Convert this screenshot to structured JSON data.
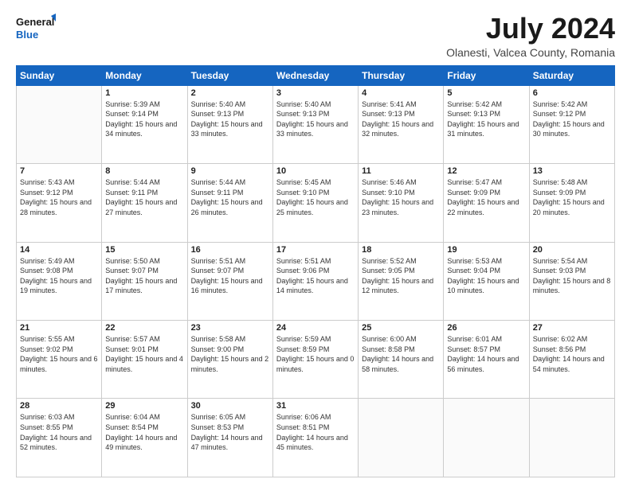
{
  "logo": {
    "line1": "General",
    "line2": "Blue"
  },
  "title": "July 2024",
  "subtitle": "Olanesti, Valcea County, Romania",
  "days": [
    "Sunday",
    "Monday",
    "Tuesday",
    "Wednesday",
    "Thursday",
    "Friday",
    "Saturday"
  ],
  "weeks": [
    [
      {
        "num": "",
        "sunrise": "",
        "sunset": "",
        "daylight": ""
      },
      {
        "num": "1",
        "sunrise": "5:39 AM",
        "sunset": "9:14 PM",
        "daylight": "15 hours and 34 minutes."
      },
      {
        "num": "2",
        "sunrise": "5:40 AM",
        "sunset": "9:13 PM",
        "daylight": "15 hours and 33 minutes."
      },
      {
        "num": "3",
        "sunrise": "5:40 AM",
        "sunset": "9:13 PM",
        "daylight": "15 hours and 33 minutes."
      },
      {
        "num": "4",
        "sunrise": "5:41 AM",
        "sunset": "9:13 PM",
        "daylight": "15 hours and 32 minutes."
      },
      {
        "num": "5",
        "sunrise": "5:42 AM",
        "sunset": "9:13 PM",
        "daylight": "15 hours and 31 minutes."
      },
      {
        "num": "6",
        "sunrise": "5:42 AM",
        "sunset": "9:12 PM",
        "daylight": "15 hours and 30 minutes."
      }
    ],
    [
      {
        "num": "7",
        "sunrise": "5:43 AM",
        "sunset": "9:12 PM",
        "daylight": "15 hours and 28 minutes."
      },
      {
        "num": "8",
        "sunrise": "5:44 AM",
        "sunset": "9:11 PM",
        "daylight": "15 hours and 27 minutes."
      },
      {
        "num": "9",
        "sunrise": "5:44 AM",
        "sunset": "9:11 PM",
        "daylight": "15 hours and 26 minutes."
      },
      {
        "num": "10",
        "sunrise": "5:45 AM",
        "sunset": "9:10 PM",
        "daylight": "15 hours and 25 minutes."
      },
      {
        "num": "11",
        "sunrise": "5:46 AM",
        "sunset": "9:10 PM",
        "daylight": "15 hours and 23 minutes."
      },
      {
        "num": "12",
        "sunrise": "5:47 AM",
        "sunset": "9:09 PM",
        "daylight": "15 hours and 22 minutes."
      },
      {
        "num": "13",
        "sunrise": "5:48 AM",
        "sunset": "9:09 PM",
        "daylight": "15 hours and 20 minutes."
      }
    ],
    [
      {
        "num": "14",
        "sunrise": "5:49 AM",
        "sunset": "9:08 PM",
        "daylight": "15 hours and 19 minutes."
      },
      {
        "num": "15",
        "sunrise": "5:50 AM",
        "sunset": "9:07 PM",
        "daylight": "15 hours and 17 minutes."
      },
      {
        "num": "16",
        "sunrise": "5:51 AM",
        "sunset": "9:07 PM",
        "daylight": "15 hours and 16 minutes."
      },
      {
        "num": "17",
        "sunrise": "5:51 AM",
        "sunset": "9:06 PM",
        "daylight": "15 hours and 14 minutes."
      },
      {
        "num": "18",
        "sunrise": "5:52 AM",
        "sunset": "9:05 PM",
        "daylight": "15 hours and 12 minutes."
      },
      {
        "num": "19",
        "sunrise": "5:53 AM",
        "sunset": "9:04 PM",
        "daylight": "15 hours and 10 minutes."
      },
      {
        "num": "20",
        "sunrise": "5:54 AM",
        "sunset": "9:03 PM",
        "daylight": "15 hours and 8 minutes."
      }
    ],
    [
      {
        "num": "21",
        "sunrise": "5:55 AM",
        "sunset": "9:02 PM",
        "daylight": "15 hours and 6 minutes."
      },
      {
        "num": "22",
        "sunrise": "5:57 AM",
        "sunset": "9:01 PM",
        "daylight": "15 hours and 4 minutes."
      },
      {
        "num": "23",
        "sunrise": "5:58 AM",
        "sunset": "9:00 PM",
        "daylight": "15 hours and 2 minutes."
      },
      {
        "num": "24",
        "sunrise": "5:59 AM",
        "sunset": "8:59 PM",
        "daylight": "15 hours and 0 minutes."
      },
      {
        "num": "25",
        "sunrise": "6:00 AM",
        "sunset": "8:58 PM",
        "daylight": "14 hours and 58 minutes."
      },
      {
        "num": "26",
        "sunrise": "6:01 AM",
        "sunset": "8:57 PM",
        "daylight": "14 hours and 56 minutes."
      },
      {
        "num": "27",
        "sunrise": "6:02 AM",
        "sunset": "8:56 PM",
        "daylight": "14 hours and 54 minutes."
      }
    ],
    [
      {
        "num": "28",
        "sunrise": "6:03 AM",
        "sunset": "8:55 PM",
        "daylight": "14 hours and 52 minutes."
      },
      {
        "num": "29",
        "sunrise": "6:04 AM",
        "sunset": "8:54 PM",
        "daylight": "14 hours and 49 minutes."
      },
      {
        "num": "30",
        "sunrise": "6:05 AM",
        "sunset": "8:53 PM",
        "daylight": "14 hours and 47 minutes."
      },
      {
        "num": "31",
        "sunrise": "6:06 AM",
        "sunset": "8:51 PM",
        "daylight": "14 hours and 45 minutes."
      },
      {
        "num": "",
        "sunrise": "",
        "sunset": "",
        "daylight": ""
      },
      {
        "num": "",
        "sunrise": "",
        "sunset": "",
        "daylight": ""
      },
      {
        "num": "",
        "sunrise": "",
        "sunset": "",
        "daylight": ""
      }
    ]
  ]
}
